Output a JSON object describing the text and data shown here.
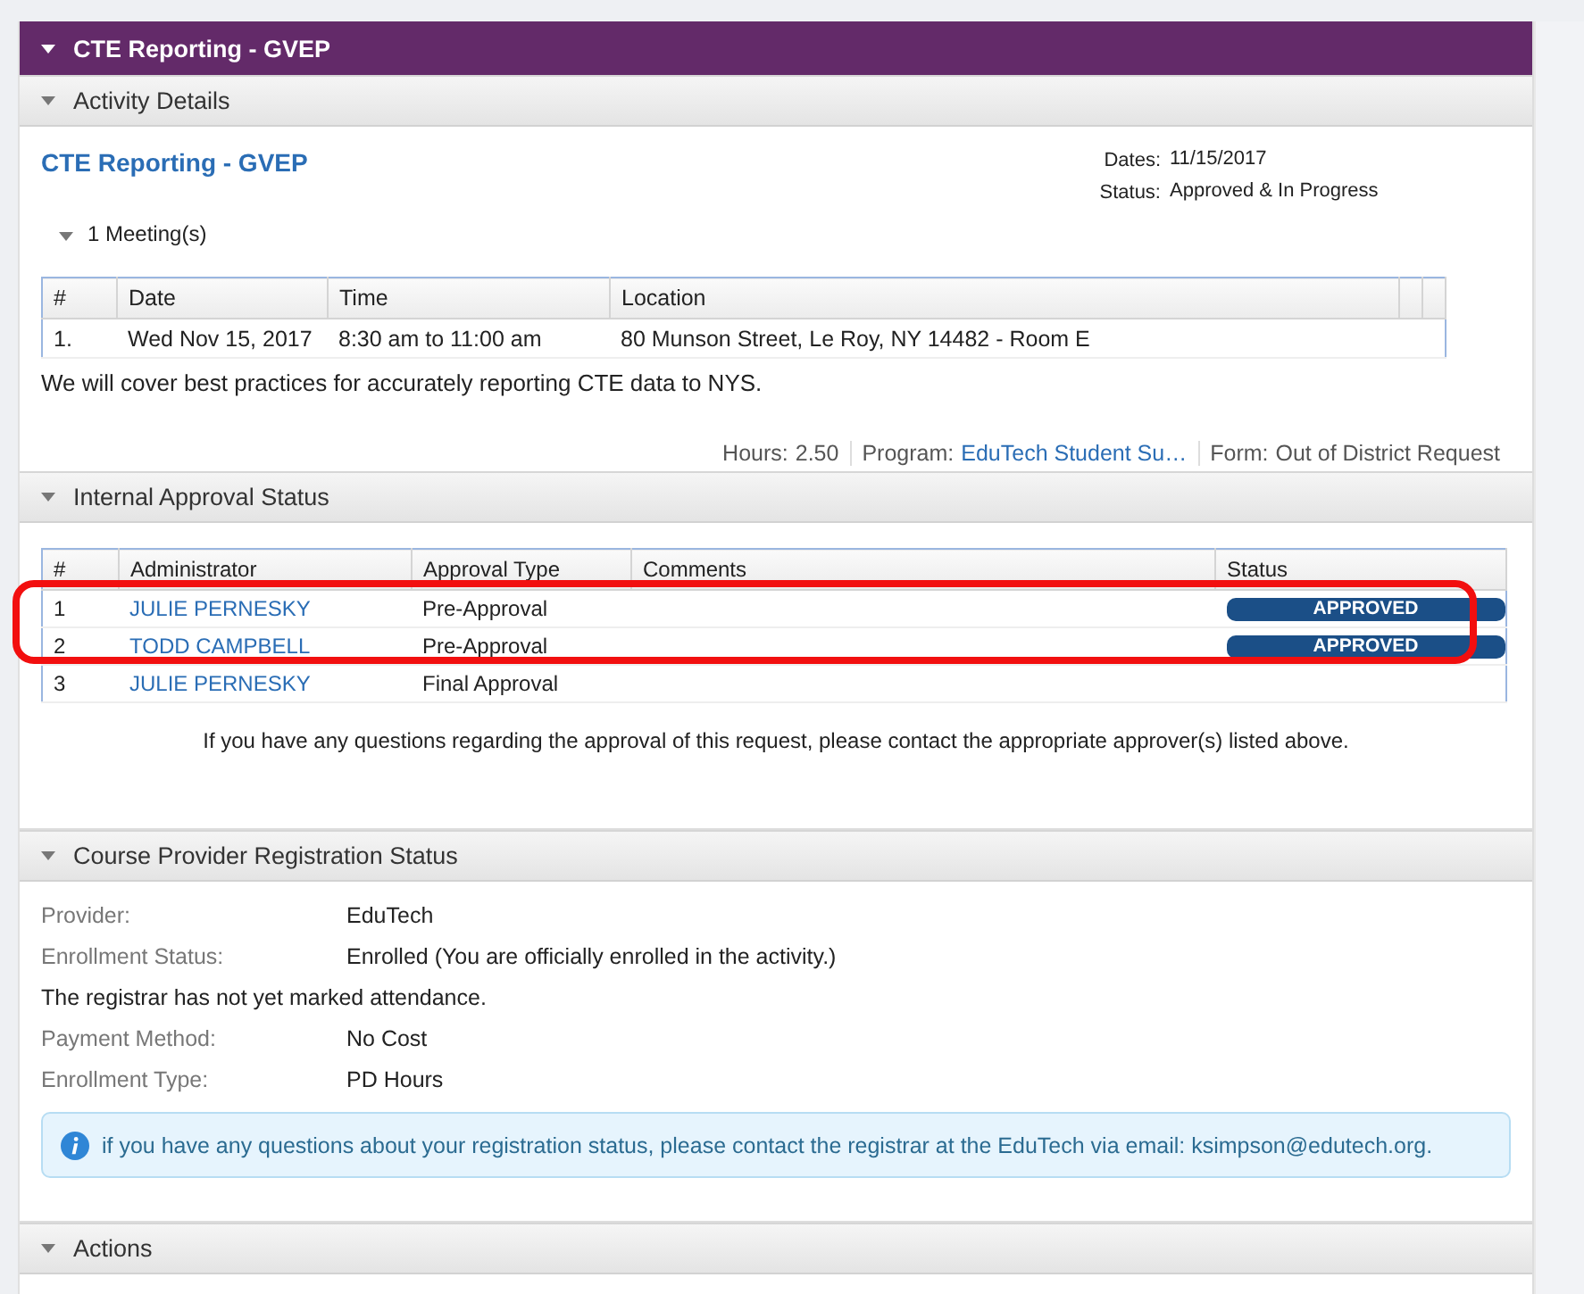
{
  "banner": {
    "title": "CTE Reporting - GVEP",
    "expanded": true
  },
  "activity": {
    "header": "Activity Details",
    "expanded": true,
    "title": "CTE Reporting - GVEP",
    "meta": [
      {
        "label": "Dates:",
        "value": "11/15/2017"
      },
      {
        "label": "Status:",
        "value": "Approved & In Progress"
      }
    ],
    "meetings": {
      "label": "1 Meeting(s)",
      "expanded": true,
      "columns": [
        "#",
        "Date",
        "Time",
        "Location"
      ],
      "rows": [
        [
          "1.",
          "Wed Nov 15, 2017",
          "8:30 am to 11:00 am",
          "80 Munson Street, Le Roy, NY 14482 - Room E"
        ]
      ]
    },
    "description": "We will cover best practices for accurately reporting CTE data to NYS.",
    "footer": [
      {
        "label": "Hours:",
        "value": "2.50",
        "kind": "plain"
      },
      {
        "label": "Program:",
        "value": "EduTech Student Su…",
        "kind": "link"
      },
      {
        "label": "Form:",
        "value": "Out of District Request",
        "kind": "plain"
      }
    ]
  },
  "approval": {
    "header": "Internal Approval Status",
    "expanded": true,
    "columns": [
      "#",
      "Administrator",
      "Approval Type",
      "Comments",
      "Status"
    ],
    "rows": [
      {
        "number": "1",
        "administrator": "JULIE PERNESKY",
        "type": "Pre-Approval",
        "status": "APPROVED"
      },
      {
        "number": "2",
        "administrator": "TODD CAMPBELL",
        "type": "Pre-Approval",
        "status": "APPROVED"
      },
      {
        "number": "3",
        "administrator": "JULIE PERNESKY",
        "type": "Final Approval"
      }
    ],
    "highlighted_rows": true,
    "note": "If you have any questions regarding the approval of this request, please contact the appropriate approver(s) listed above."
  },
  "registration": {
    "header": "Course Provider Registration Status",
    "expanded": true,
    "rows": [
      {
        "kind": "field",
        "label": "Provider:",
        "value": "EduTech"
      },
      {
        "kind": "field",
        "label": "Enrollment Status:",
        "value": "Enrolled (You are officially enrolled in the activity.)"
      },
      {
        "kind": "note",
        "text": "The registrar has not yet marked attendance."
      },
      {
        "kind": "field",
        "label": "Payment Method:",
        "value": "No Cost"
      },
      {
        "kind": "field",
        "label": "Enrollment Type:",
        "value": "PD Hours"
      }
    ],
    "info": "if you have any questions about your registration status, please contact the registrar at the EduTech via email: ksimpson@edutech.org."
  },
  "actions": {
    "header": "Actions",
    "expanded": true
  }
}
